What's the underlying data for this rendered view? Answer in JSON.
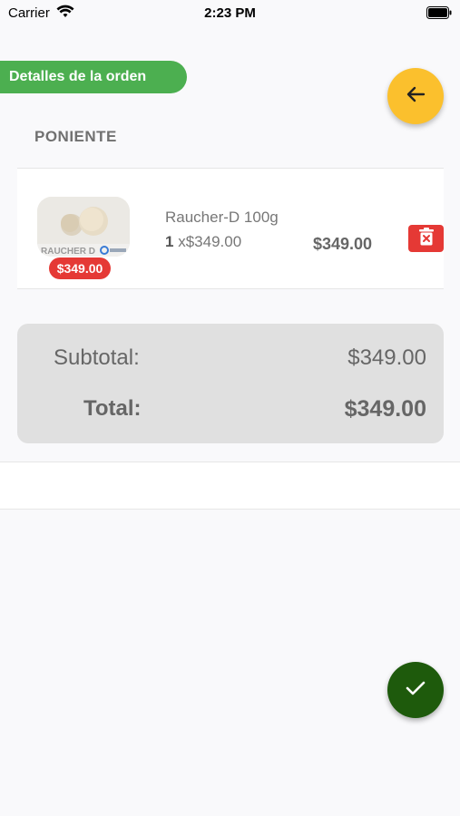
{
  "status_bar": {
    "carrier": "Carrier",
    "time": "2:23 PM",
    "icons": [
      "wifi-icon",
      "battery-icon"
    ]
  },
  "header": {
    "section_title": "Detalles de la orden",
    "back_icon": "arrow-left-icon"
  },
  "store": {
    "name": "PONIENTE"
  },
  "cart_items": [
    {
      "name": "Raucher-D 100g",
      "quantity": "1",
      "unit_price": "x$349.00",
      "price_badge": "$349.00",
      "line_total": "$349.00",
      "image_caption": "RAUCHER D",
      "delete_icon": "trash-icon"
    }
  ],
  "summary": {
    "subtotal_label": "Subtotal:",
    "subtotal_value": "$349.00",
    "total_label": "Total:",
    "total_value": "$349.00"
  },
  "actions": {
    "confirm_icon": "check-icon"
  },
  "colors": {
    "tag_green": "#4caf50",
    "back_yellow": "#fbc02d",
    "confirm_green": "#1e5a0c",
    "danger_red": "#e53935",
    "panel_gray": "#e0e0e0"
  }
}
